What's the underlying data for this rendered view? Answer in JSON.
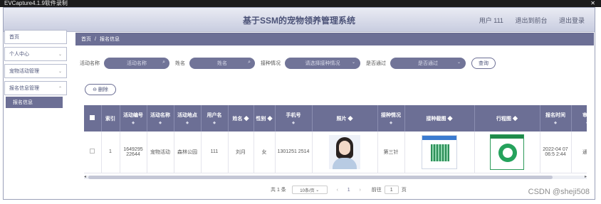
{
  "capture_bar": {
    "title": "EVCapture4.1.9软件录制",
    "controls": "✕"
  },
  "header": {
    "title": "基于SSM的宠物领养管理系统",
    "user_label": "用户 111",
    "back_label": "退出到前台",
    "logout_label": "退出登录"
  },
  "sidebar": {
    "items": [
      {
        "label": "首页",
        "has_chevron": false
      },
      {
        "label": "个人中心",
        "has_chevron": true
      },
      {
        "label": "宠物活动管理",
        "has_chevron": true
      },
      {
        "label": "报名信息管理",
        "has_chevron": true
      }
    ],
    "active_sub": "报名信息"
  },
  "breadcrumb": {
    "home": "首页",
    "separator": "/",
    "current": "报名信息"
  },
  "filters": {
    "activity_name_label": "活动名称",
    "activity_name_placeholder": "活动名称",
    "name_label": "姓名",
    "name_placeholder": "姓名",
    "vaccine_label": "接种情况",
    "vaccine_placeholder": "请选择接种情况",
    "approved_label": "是否通过",
    "approved_placeholder": "是否通过",
    "search_label": "查询"
  },
  "delete_label": "删除",
  "table": {
    "headers": [
      "",
      "索引",
      "活动编号",
      "活动名称",
      "活动地点",
      "用户名",
      "姓名",
      "性别",
      "手机号",
      "照片",
      "接种情况",
      "接种截图",
      "行程图",
      "报名时间",
      "审核"
    ],
    "rows": [
      {
        "index": "1",
        "activity_no": "1649295 22644",
        "activity_name": "宠物活动",
        "location": "森林公园",
        "username": "111",
        "name": "刘月",
        "gender": "女",
        "phone": "1301251 2514",
        "vaccine": "第三针",
        "signup_time": "2022-04 07 06:5 2:44",
        "review": "通过"
      }
    ]
  },
  "pagination": {
    "total": "共 1 条",
    "page_size": "10条/页",
    "prev": "‹",
    "current": "1",
    "next": "›",
    "goto_label": "前往",
    "goto_value": "1",
    "page_suffix": "页"
  },
  "watermark": "CSDN @sheji508"
}
